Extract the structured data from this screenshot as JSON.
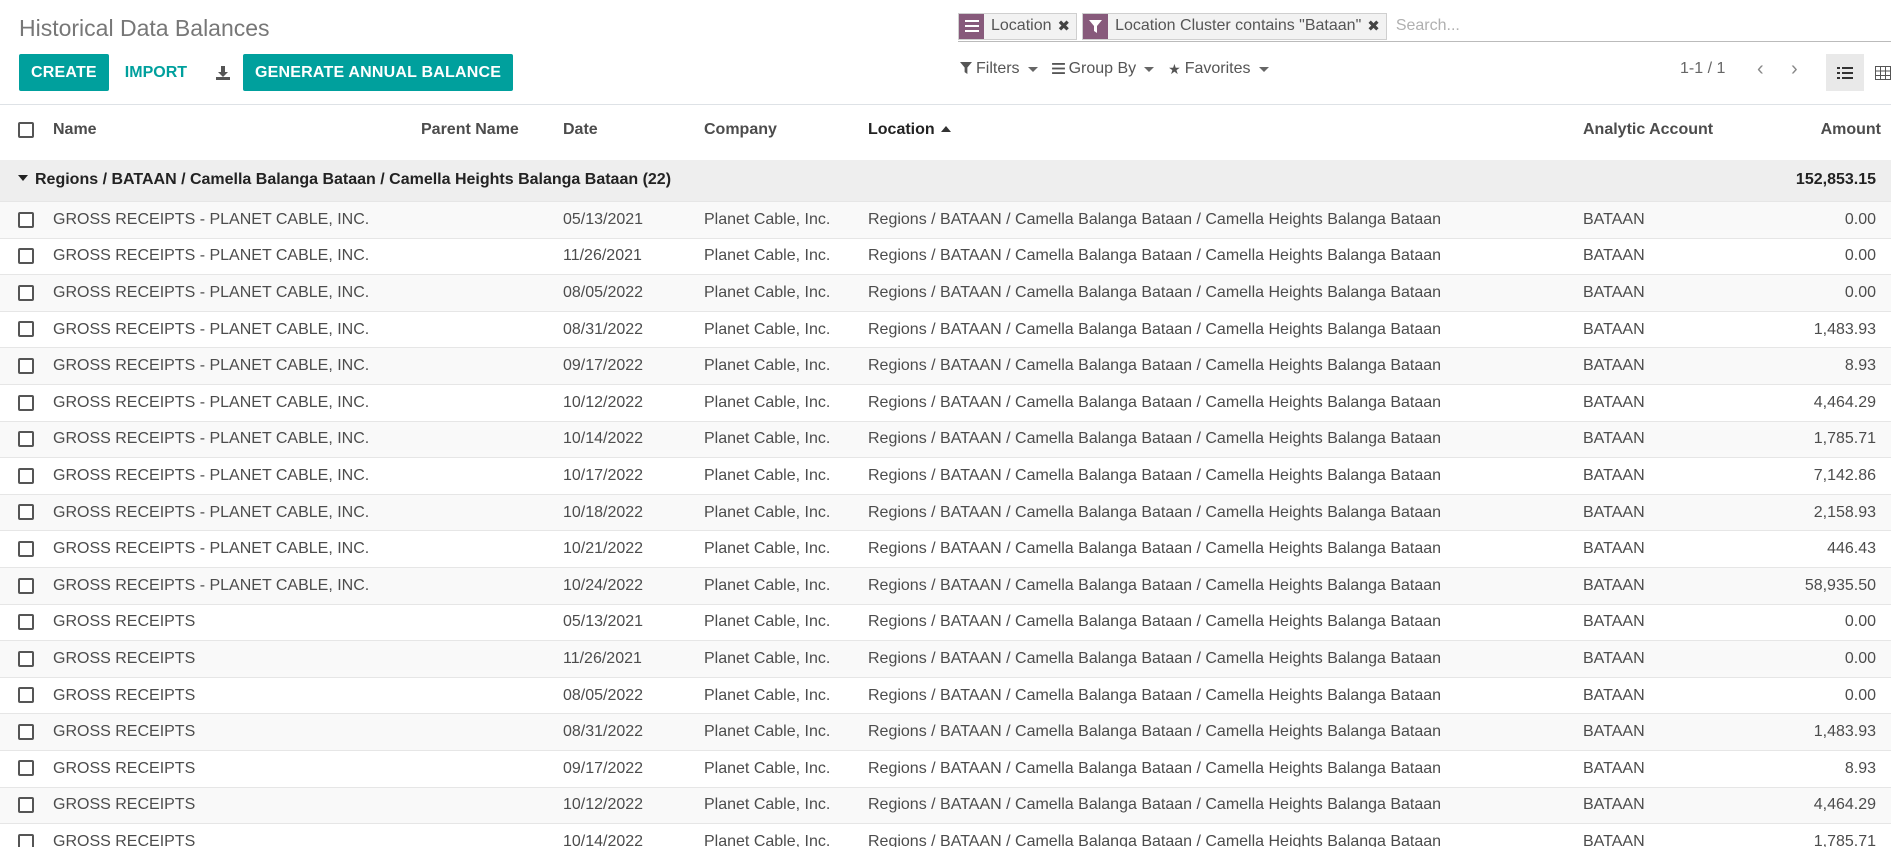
{
  "page": {
    "title": "Historical Data Balances"
  },
  "toolbar": {
    "create_label": "CREATE",
    "import_label": "IMPORT",
    "generate_label": "GENERATE ANNUAL BALANCE"
  },
  "search": {
    "facets": [
      {
        "label": "Location",
        "icon": "list-icon"
      },
      {
        "label": "Location Cluster contains \"Bataan\"",
        "icon": "filter-icon"
      }
    ],
    "placeholder": "Search..."
  },
  "filters": {
    "filters_label": "Filters",
    "groupby_label": "Group By",
    "favorites_label": "Favorites"
  },
  "pager": {
    "value": "1-1 / 1"
  },
  "colors": {
    "accent": "#00a09d",
    "facet": "#875a7b"
  },
  "table": {
    "headers": {
      "name": "Name",
      "parent_name": "Parent Name",
      "date": "Date",
      "company": "Company",
      "location": "Location",
      "analytic_account": "Analytic Account",
      "amount": "Amount"
    },
    "group": {
      "label": "Regions / BATAAN / Camella Balanga Bataan / Camella Heights Balanga Bataan (22)",
      "total": "152,853.15"
    },
    "rows": [
      {
        "name": "GROSS RECEIPTS - PLANET CABLE, INC.",
        "parent": "",
        "date": "05/13/2021",
        "company": "Planet Cable, Inc.",
        "location": "Regions / BATAAN / Camella Balanga Bataan / Camella Heights Balanga Bataan",
        "account": "BATAAN",
        "amount": "0.00"
      },
      {
        "name": "GROSS RECEIPTS - PLANET CABLE, INC.",
        "parent": "",
        "date": "11/26/2021",
        "company": "Planet Cable, Inc.",
        "location": "Regions / BATAAN / Camella Balanga Bataan / Camella Heights Balanga Bataan",
        "account": "BATAAN",
        "amount": "0.00"
      },
      {
        "name": "GROSS RECEIPTS - PLANET CABLE, INC.",
        "parent": "",
        "date": "08/05/2022",
        "company": "Planet Cable, Inc.",
        "location": "Regions / BATAAN / Camella Balanga Bataan / Camella Heights Balanga Bataan",
        "account": "BATAAN",
        "amount": "0.00"
      },
      {
        "name": "GROSS RECEIPTS - PLANET CABLE, INC.",
        "parent": "",
        "date": "08/31/2022",
        "company": "Planet Cable, Inc.",
        "location": "Regions / BATAAN / Camella Balanga Bataan / Camella Heights Balanga Bataan",
        "account": "BATAAN",
        "amount": "1,483.93"
      },
      {
        "name": "GROSS RECEIPTS - PLANET CABLE, INC.",
        "parent": "",
        "date": "09/17/2022",
        "company": "Planet Cable, Inc.",
        "location": "Regions / BATAAN / Camella Balanga Bataan / Camella Heights Balanga Bataan",
        "account": "BATAAN",
        "amount": "8.93"
      },
      {
        "name": "GROSS RECEIPTS - PLANET CABLE, INC.",
        "parent": "",
        "date": "10/12/2022",
        "company": "Planet Cable, Inc.",
        "location": "Regions / BATAAN / Camella Balanga Bataan / Camella Heights Balanga Bataan",
        "account": "BATAAN",
        "amount": "4,464.29"
      },
      {
        "name": "GROSS RECEIPTS - PLANET CABLE, INC.",
        "parent": "",
        "date": "10/14/2022",
        "company": "Planet Cable, Inc.",
        "location": "Regions / BATAAN / Camella Balanga Bataan / Camella Heights Balanga Bataan",
        "account": "BATAAN",
        "amount": "1,785.71"
      },
      {
        "name": "GROSS RECEIPTS - PLANET CABLE, INC.",
        "parent": "",
        "date": "10/17/2022",
        "company": "Planet Cable, Inc.",
        "location": "Regions / BATAAN / Camella Balanga Bataan / Camella Heights Balanga Bataan",
        "account": "BATAAN",
        "amount": "7,142.86"
      },
      {
        "name": "GROSS RECEIPTS - PLANET CABLE, INC.",
        "parent": "",
        "date": "10/18/2022",
        "company": "Planet Cable, Inc.",
        "location": "Regions / BATAAN / Camella Balanga Bataan / Camella Heights Balanga Bataan",
        "account": "BATAAN",
        "amount": "2,158.93"
      },
      {
        "name": "GROSS RECEIPTS - PLANET CABLE, INC.",
        "parent": "",
        "date": "10/21/2022",
        "company": "Planet Cable, Inc.",
        "location": "Regions / BATAAN / Camella Balanga Bataan / Camella Heights Balanga Bataan",
        "account": "BATAAN",
        "amount": "446.43"
      },
      {
        "name": "GROSS RECEIPTS - PLANET CABLE, INC.",
        "parent": "",
        "date": "10/24/2022",
        "company": "Planet Cable, Inc.",
        "location": "Regions / BATAAN / Camella Balanga Bataan / Camella Heights Balanga Bataan",
        "account": "BATAAN",
        "amount": "58,935.50"
      },
      {
        "name": "GROSS RECEIPTS",
        "parent": "",
        "date": "05/13/2021",
        "company": "Planet Cable, Inc.",
        "location": "Regions / BATAAN / Camella Balanga Bataan / Camella Heights Balanga Bataan",
        "account": "BATAAN",
        "amount": "0.00"
      },
      {
        "name": "GROSS RECEIPTS",
        "parent": "",
        "date": "11/26/2021",
        "company": "Planet Cable, Inc.",
        "location": "Regions / BATAAN / Camella Balanga Bataan / Camella Heights Balanga Bataan",
        "account": "BATAAN",
        "amount": "0.00"
      },
      {
        "name": "GROSS RECEIPTS",
        "parent": "",
        "date": "08/05/2022",
        "company": "Planet Cable, Inc.",
        "location": "Regions / BATAAN / Camella Balanga Bataan / Camella Heights Balanga Bataan",
        "account": "BATAAN",
        "amount": "0.00"
      },
      {
        "name": "GROSS RECEIPTS",
        "parent": "",
        "date": "08/31/2022",
        "company": "Planet Cable, Inc.",
        "location": "Regions / BATAAN / Camella Balanga Bataan / Camella Heights Balanga Bataan",
        "account": "BATAAN",
        "amount": "1,483.93"
      },
      {
        "name": "GROSS RECEIPTS",
        "parent": "",
        "date": "09/17/2022",
        "company": "Planet Cable, Inc.",
        "location": "Regions / BATAAN / Camella Balanga Bataan / Camella Heights Balanga Bataan",
        "account": "BATAAN",
        "amount": "8.93"
      },
      {
        "name": "GROSS RECEIPTS",
        "parent": "",
        "date": "10/12/2022",
        "company": "Planet Cable, Inc.",
        "location": "Regions / BATAAN / Camella Balanga Bataan / Camella Heights Balanga Bataan",
        "account": "BATAAN",
        "amount": "4,464.29"
      },
      {
        "name": "GROSS RECEIPTS",
        "parent": "",
        "date": "10/14/2022",
        "company": "Planet Cable, Inc.",
        "location": "Regions / BATAAN / Camella Balanga Bataan / Camella Heights Balanga Bataan",
        "account": "BATAAN",
        "amount": "1,785.71"
      }
    ]
  }
}
